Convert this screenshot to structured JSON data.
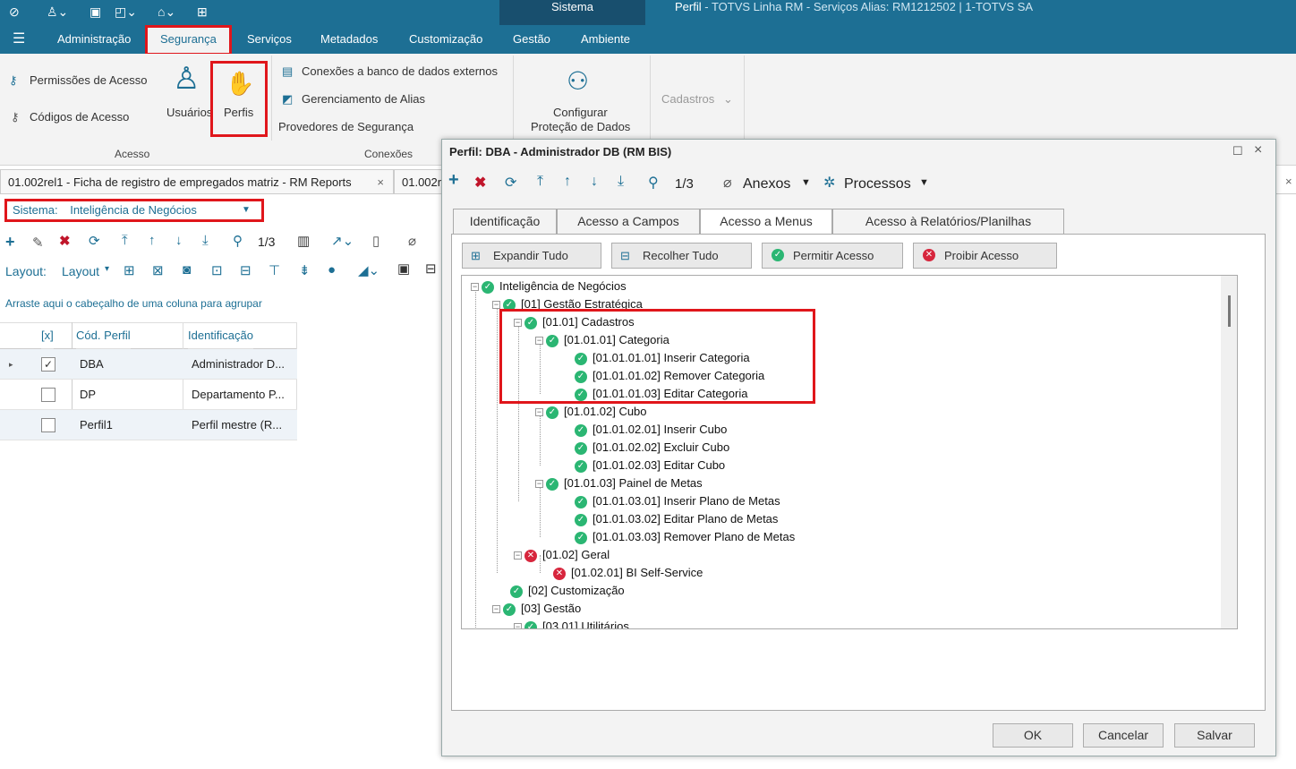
{
  "titlebar": {
    "context_tab": "Sistema",
    "title_bold": "Perfil",
    "title_rest": " - TOTVS Linha RM - Serviços  Alias: RM1212502 | 1-TOTVS SA"
  },
  "menu": {
    "tabs": [
      "Administração",
      "Segurança",
      "Serviços",
      "Metadados",
      "Customização",
      "Gestão",
      "Ambiente"
    ]
  },
  "ribbon": {
    "permissoes": "Permissões de Acesso",
    "codigos": "Códigos de Acesso",
    "usuarios": "Usuários",
    "perfis": "Perfis",
    "group_acesso": "Acesso",
    "conexoes_banco": "Conexões a banco de dados externos",
    "gerenciamento_alias": "Gerenciamento de Alias",
    "provedores": "Provedores de Segurança",
    "group_conexoes": "Conexões",
    "configurar": "Configurar",
    "protecao": "Proteção de Dados",
    "cadastros": "Cadastros"
  },
  "doc_tabs": {
    "tab1": "01.002rel1 - Ficha de registro de empregados matriz - RM Reports",
    "tab2": "01.002r"
  },
  "left": {
    "sistema_label": "Sistema:",
    "sistema_value": "Inteligência de Negócios",
    "page": "1/3",
    "layout_label": "Layout:",
    "layout_btn": "Layout",
    "group_hint": "Arraste aqui o cabeçalho de uma coluna para agrupar",
    "grid_headers": [
      "[x]",
      "Cód. Perfil",
      "Identificação"
    ],
    "rows": [
      {
        "code": "DBA",
        "ident": "Administrador D...",
        "checked": "✓"
      },
      {
        "code": "DP",
        "ident": "Departamento P...",
        "checked": ""
      },
      {
        "code": "Perfil1",
        "ident": "Perfil mestre (R...",
        "checked": ""
      }
    ]
  },
  "dialog": {
    "title": "Perfil: DBA - Administrador DB (RM BIS)",
    "page": "1/3",
    "anexos": "Anexos",
    "processos": "Processos",
    "tabs": [
      "Identificação",
      "Acesso a Campos",
      "Acesso a Menus",
      "Acesso à Relatórios/Planilhas"
    ],
    "actions": {
      "expandir": "Expandir Tudo",
      "recolher": "Recolher Tudo",
      "permitir": "Permitir Acesso",
      "proibir": "Proibir Acesso"
    },
    "tree": [
      {
        "label": "Inteligência de Negócios",
        "status": "ok"
      },
      {
        "label": "[01] Gestão Estratégica",
        "status": "ok"
      },
      {
        "label": "[01.01] Cadastros",
        "status": "ok"
      },
      {
        "label": "[01.01.01] Categoria",
        "status": "ok"
      },
      {
        "label": "[01.01.01.01] Inserir Categoria",
        "status": "ok"
      },
      {
        "label": "[01.01.01.02] Remover Categoria",
        "status": "ok"
      },
      {
        "label": "[01.01.01.03] Editar Categoria",
        "status": "ok"
      },
      {
        "label": "[01.01.02] Cubo",
        "status": "ok"
      },
      {
        "label": "[01.01.02.01] Inserir Cubo",
        "status": "ok"
      },
      {
        "label": "[01.01.02.02] Excluir Cubo",
        "status": "ok"
      },
      {
        "label": "[01.01.02.03] Editar Cubo",
        "status": "ok"
      },
      {
        "label": "[01.01.03] Painel de Metas",
        "status": "ok"
      },
      {
        "label": "[01.01.03.01] Inserir Plano de Metas",
        "status": "ok"
      },
      {
        "label": "[01.01.03.02] Editar Plano de Metas",
        "status": "ok"
      },
      {
        "label": "[01.01.03.03] Remover Plano de Metas",
        "status": "ok"
      },
      {
        "label": "[01.02] Geral",
        "status": "no"
      },
      {
        "label": "[01.02.01] BI Self-Service",
        "status": "no"
      },
      {
        "label": "[02] Customização",
        "status": "ok"
      },
      {
        "label": "[03] Gestão",
        "status": "ok"
      },
      {
        "label": "[03.01] Utilitários",
        "status": "ok"
      }
    ],
    "buttons": {
      "ok": "OK",
      "cancelar": "Cancelar",
      "salvar": "Salvar"
    }
  },
  "colors": {
    "brand": "#1d6f94",
    "highlight": "#e0161b",
    "ok": "#2bb673",
    "no": "#d7263d"
  }
}
